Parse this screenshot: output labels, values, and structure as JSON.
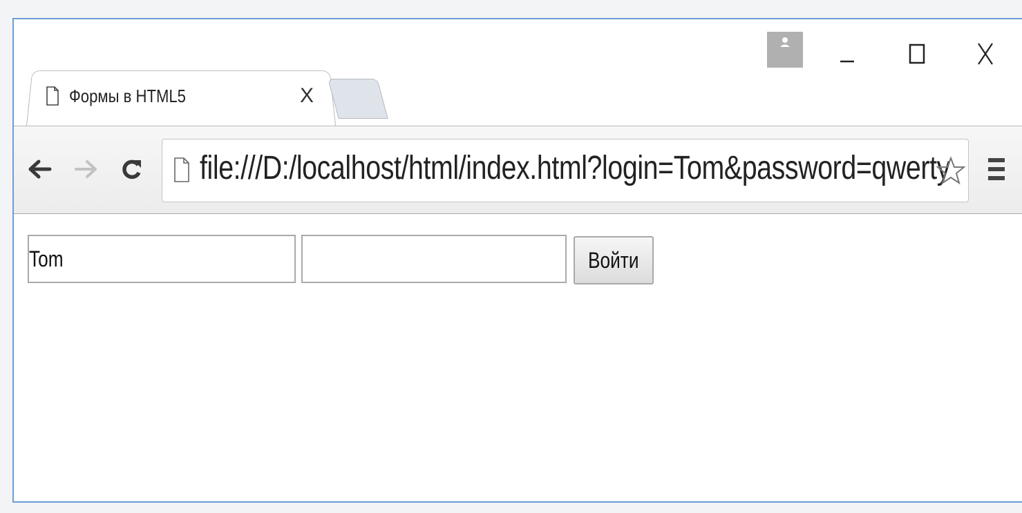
{
  "tab": {
    "title": "Формы в HTML5",
    "close_glyph": "X",
    "icon": "page-icon"
  },
  "window_controls": {
    "minimize_glyph": "–",
    "maximize_glyph": "□",
    "close_glyph": "X"
  },
  "toolbar": {
    "url": "file:///D:/localhost/html/index.html?login=Tom&password=qwerty",
    "back_icon": "back-arrow-icon",
    "forward_icon": "forward-arrow-icon",
    "reload_icon": "reload-icon",
    "bookmark_icon": "star-icon",
    "menu_icon": "hamburger-menu-icon"
  },
  "form": {
    "login_value": "Tom",
    "password_value": "",
    "submit_label": "Войти"
  },
  "colors": {
    "window_border": "#6c9dd3",
    "url_highlight": "#e8202a",
    "profile_bg": "#b0b0b0"
  }
}
